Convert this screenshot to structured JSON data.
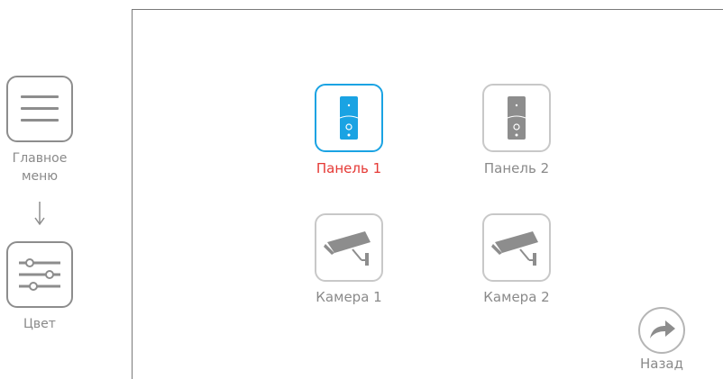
{
  "breadcrumb": {
    "main_menu_label": "Главное\nменю",
    "main_menu_icon": "hamburger-menu-icon",
    "color_label": "Цвет",
    "color_icon": "sliders-icon"
  },
  "devices": [
    {
      "label": "Панель 1",
      "icon": "door-panel-icon",
      "selected": true
    },
    {
      "label": "Панель 2",
      "icon": "door-panel-icon",
      "selected": false
    },
    {
      "label": "Камера 1",
      "icon": "cctv-camera-icon",
      "selected": false
    },
    {
      "label": "Камера 2",
      "icon": "cctv-camera-icon",
      "selected": false
    }
  ],
  "back": {
    "label": "Назад",
    "icon": "back-arrow-icon"
  },
  "colors": {
    "accent": "#1aa3e3",
    "selected_text": "#e53935",
    "icon_gray": "#8d8d8d",
    "label_gray": "#8a8a8a"
  }
}
